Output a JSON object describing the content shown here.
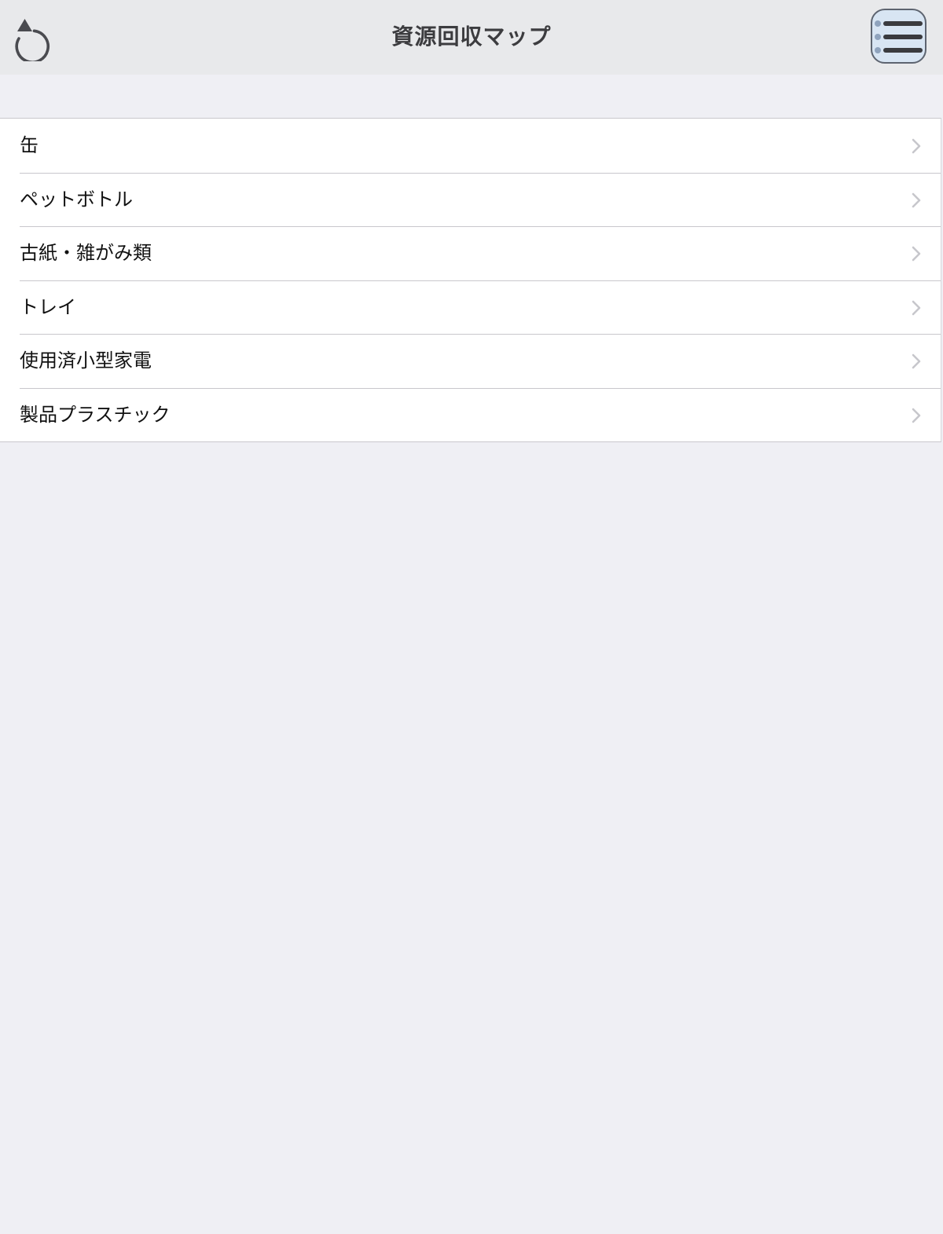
{
  "navbar": {
    "title": "資源回収マップ",
    "left_icon": "refresh-icon",
    "right_icon": "menu-list-icon"
  },
  "list": {
    "items": [
      {
        "label": "缶"
      },
      {
        "label": "ペットボトル"
      },
      {
        "label": "古紙・雑がみ類"
      },
      {
        "label": "トレイ"
      },
      {
        "label": "使用済小型家電"
      },
      {
        "label": "製品プラスチック"
      }
    ],
    "accessory_icon": "chevron-right-icon"
  },
  "colors": {
    "background": "#efeff4",
    "navbar": "#e8e9eb",
    "menu_button": "#d8e5f3",
    "separator": "#c8c7cc",
    "chevron": "#c7c7cc"
  }
}
